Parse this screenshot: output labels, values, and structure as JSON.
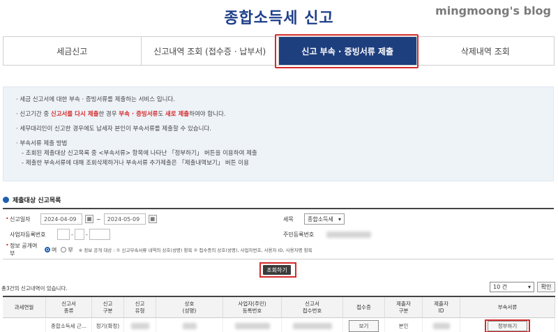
{
  "header": {
    "title": "종합소득세 신고",
    "watermark": "mingmoong's blog"
  },
  "tabs": [
    {
      "label": "세금신고"
    },
    {
      "label": "신고내역 조회 (접수증 · 납부서)"
    },
    {
      "label": "신고 부속 · 증빙서류 제출"
    },
    {
      "label": "삭제내역 조회"
    }
  ],
  "info": {
    "line1": "· 세금 신고서에 대한 부속 · 증빙서류를 제출하는 서비스 입니다.",
    "line2_a": "· 신고기간 중 ",
    "line2_b": "신고서를 다시 제출",
    "line2_c": "한 경우 ",
    "line2_d": "부속 · 증빙서류",
    "line2_e": "도 ",
    "line2_f": "새로 제출",
    "line2_g": "하여야 합니다.",
    "line3": "· 세무대리인이 신고한 경우에도 납세자 본인이 부속서류를 제출할 수 있습니다.",
    "line4": "· 부속서류 제출 방법",
    "line5": "- 조회된 제출대상 신고목록 중 <부속서류> 항목에 나타난 「정부하기」 버튼을 이용하여 제출",
    "line6": "- 제출한 부속서류에 대해 조회삭제하거나 부속서류 추가제출은 「제출내역보기」 버튼 이용"
  },
  "section": {
    "title": "제출대상 신고목록"
  },
  "search": {
    "date_label": "신고일자",
    "date_from": "2024-04-09",
    "date_sep": "~",
    "date_to": "2024-05-09",
    "tax_label": "세목",
    "tax_value": "종합소득세",
    "biz_label": "사업자등록번호",
    "rrn_label": "주민등록번호",
    "disclose_label": "정보 공개여부",
    "yes": "여",
    "no": "부",
    "disclose_note": "※ 정보 공개 대상 : ① 신고부속서류 내역의 상호(성명) 항목 ② 접수증의 상호(성명), 사업자번호, 사용자 ID, 사용자명 항목",
    "search_button": "조회하기"
  },
  "results": {
    "count_text": "총3건의 신고내역이 있습니다.",
    "page_size": "10 건",
    "confirm": "확인"
  },
  "table": {
    "headers": [
      "과세연월",
      "신고서\n종류",
      "신고\n구분",
      "신고\n유형",
      "상호\n(성명)",
      "사업자(주민)\n등록번호",
      "신고서\n접수번호",
      "접수증",
      "제출자\n구분",
      "제출자\nID",
      "부속서류"
    ],
    "row": {
      "kind": "종합소득세 근...",
      "div": "정기(확정)",
      "receipt_btn": "보기",
      "submitter": "본인",
      "attach_btn": "정부하기"
    }
  },
  "colors": {
    "accent": "#1e3f7e",
    "highlight": "#d42b2b",
    "title": "#1f3f8a"
  }
}
